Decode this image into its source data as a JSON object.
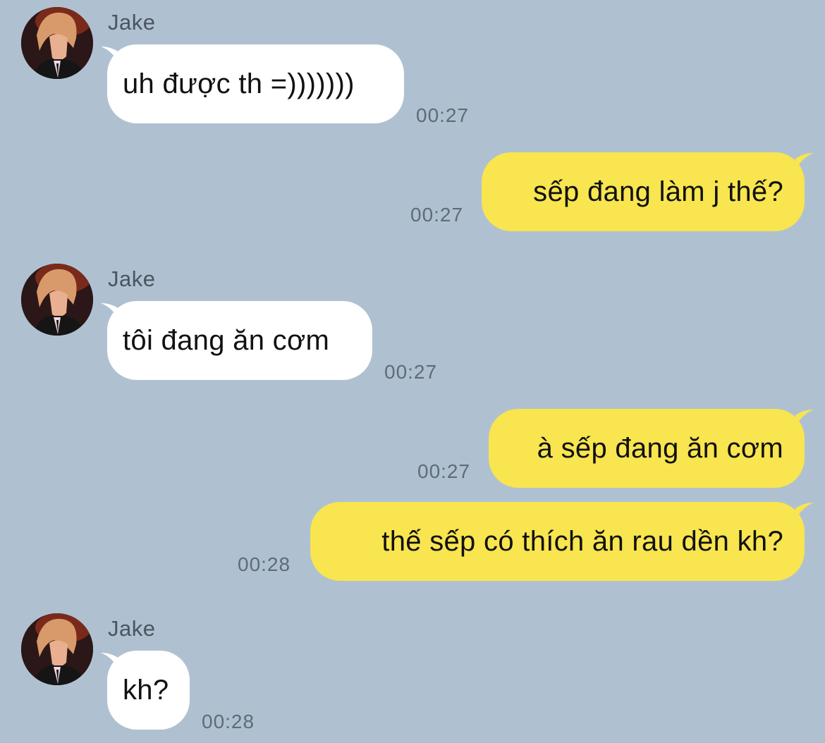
{
  "colors": {
    "background": "#afc1d1",
    "incoming_bubble": "#ffffff",
    "outgoing_bubble": "#f8e54f",
    "timestamp": "#5f6b76",
    "sender_name": "#4a5560"
  },
  "messages": [
    {
      "direction": "in",
      "sender": "Jake",
      "text": "uh được th =)))))))",
      "time": "00:27"
    },
    {
      "direction": "out",
      "text": "sếp đang làm j thế?",
      "time": "00:27"
    },
    {
      "direction": "in",
      "sender": "Jake",
      "text": "tôi đang ăn cơm",
      "time": "00:27"
    },
    {
      "direction": "out",
      "text": "à sếp đang ăn cơm",
      "time": "00:27"
    },
    {
      "direction": "out",
      "text": "thế sếp có thích ăn rau dền kh?",
      "time": "00:28"
    },
    {
      "direction": "in",
      "sender": "Jake",
      "text": "kh?",
      "time": "00:28"
    }
  ]
}
